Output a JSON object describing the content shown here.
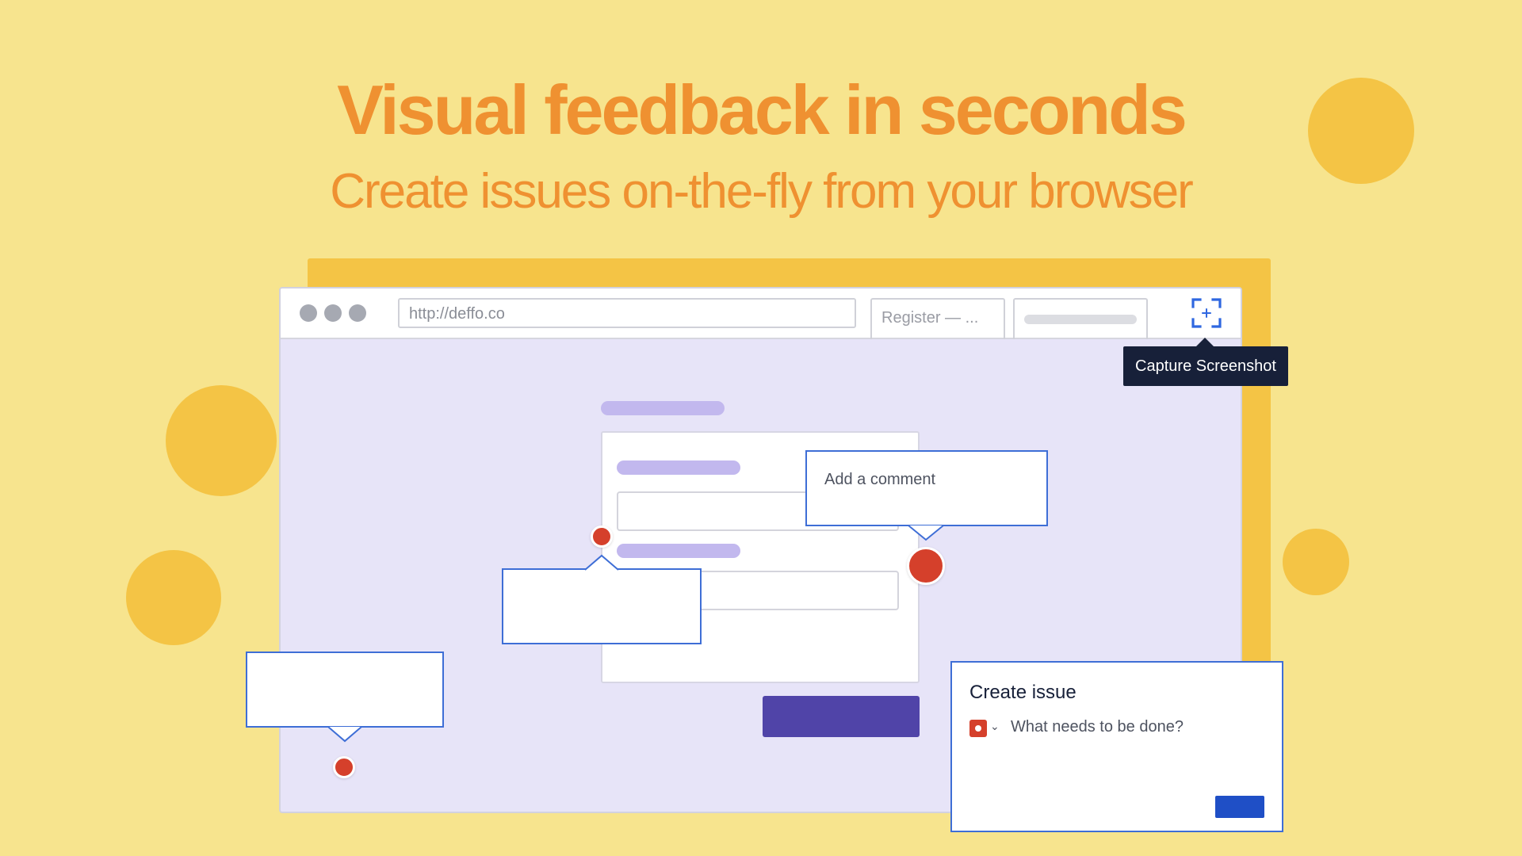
{
  "headline": "Visual feedback in seconds",
  "subheadline": "Create issues on-the-fly from your browser",
  "browser": {
    "url": "http://deffo.co",
    "tab_title": "Register — ...",
    "capture_icon": "capture-screenshot-icon",
    "capture_tooltip": "Capture Screenshot"
  },
  "comment_bubble": {
    "placeholder": "Add a comment"
  },
  "create_issue": {
    "title": "Create issue",
    "issue_type_icon": "bug-icon",
    "chevron_icon": "chevron-down-icon",
    "chevron_glyph": "⌄",
    "placeholder": "What needs to be done?"
  },
  "colors": {
    "background": "#f7e48e",
    "headline": "#ef9131",
    "accent_yellow": "#f4c445",
    "browser_canvas": "#e7e4f8",
    "marker_red": "#d5402b",
    "bubble_border": "#3e6ed6",
    "primary_purple": "#5044a8",
    "primary_blue": "#1f4fc6",
    "tooltip_bg": "#172039"
  }
}
